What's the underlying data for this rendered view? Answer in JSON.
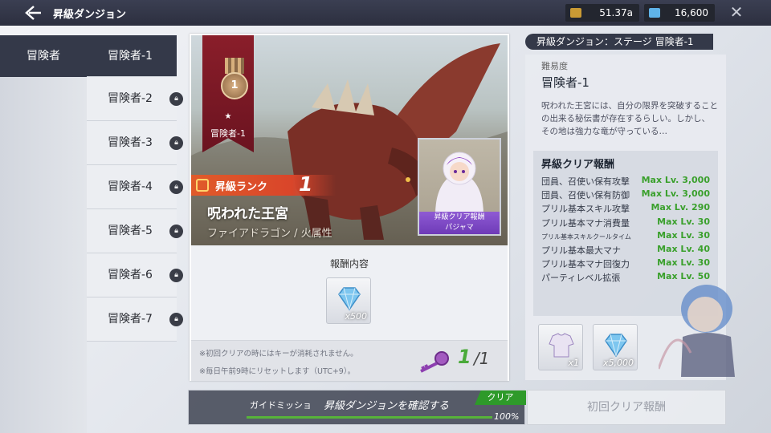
{
  "header": {
    "title": "昇級ダンジョン",
    "gold": "51.37a",
    "gems": "16,600"
  },
  "sidebar": {
    "category": "冒険者",
    "stages": [
      {
        "label": "冒険者-1",
        "locked": false
      },
      {
        "label": "冒険者-2",
        "locked": true
      },
      {
        "label": "冒険者-3",
        "locked": true
      },
      {
        "label": "冒険者-4",
        "locked": true
      },
      {
        "label": "冒険者-5",
        "locked": true
      },
      {
        "label": "冒険者-6",
        "locked": true
      },
      {
        "label": "冒険者-7",
        "locked": true
      }
    ]
  },
  "card": {
    "banner_number": "1",
    "banner_star": "★",
    "banner_name": "冒険者-1",
    "rank_label": "昇級ランク",
    "rank_value": "1",
    "dungeon_name": "呪われた王宮",
    "dungeon_sub": "ファイアドラゴン / 火属性",
    "portrait_label_1": "昇級クリア報酬",
    "portrait_label_2": "パジャマ",
    "reward_heading": "報酬内容",
    "reward_qty": "x500",
    "note_1": "※初回クリアの時にはキーが消耗されません。",
    "note_2": "※毎日午前9時にリセットします（UTC+9）。",
    "key_count": "1",
    "key_total": "/1"
  },
  "detail": {
    "header": "昇級ダンジョン：ステージ 冒険者-1",
    "difficulty_label": "難易度",
    "difficulty_value": "冒険者-1",
    "description": "呪われた王宮には、自分の限界を突破することの出来る秘伝書が存在するらしい。しかし、その地は強力な竜が守っている…",
    "clear_heading": "昇級クリア報酬",
    "rows": [
      {
        "k": "団員、召使い保有攻撃",
        "v": "Max Lv. 3,000"
      },
      {
        "k": "団員、召使い保有防御",
        "v": "Max Lv. 3,000"
      },
      {
        "k": "プリル基本スキル攻撃",
        "v": "Max Lv. 290"
      },
      {
        "k": "プリル基本マナ消費量",
        "v": "Max Lv. 30"
      },
      {
        "k": "プリル基本スキルクールタイム",
        "v": "Max Lv. 30"
      },
      {
        "k": "プリル基本最大マナ",
        "v": "Max Lv. 40"
      },
      {
        "k": "プリル基本マナ回復力",
        "v": "Max Lv. 30"
      },
      {
        "k": "パーティレベル拡張",
        "v": "Max Lv. 50"
      }
    ],
    "item_1_qty": "x1",
    "item_2_qty": "x5,000"
  },
  "bottom": {
    "guide_label": "ガイドミッショ",
    "guide_text": "昇級ダンジョンを確認する",
    "guide_clear": "クリア",
    "guide_pct": "100%",
    "first_clear_button": "初回クリア報酬"
  },
  "colors": {
    "header_bg": "#2c2f3f",
    "active_tab": "#343949",
    "max_lv_green": "#3aa02c",
    "rank_red": "#d9452a"
  }
}
